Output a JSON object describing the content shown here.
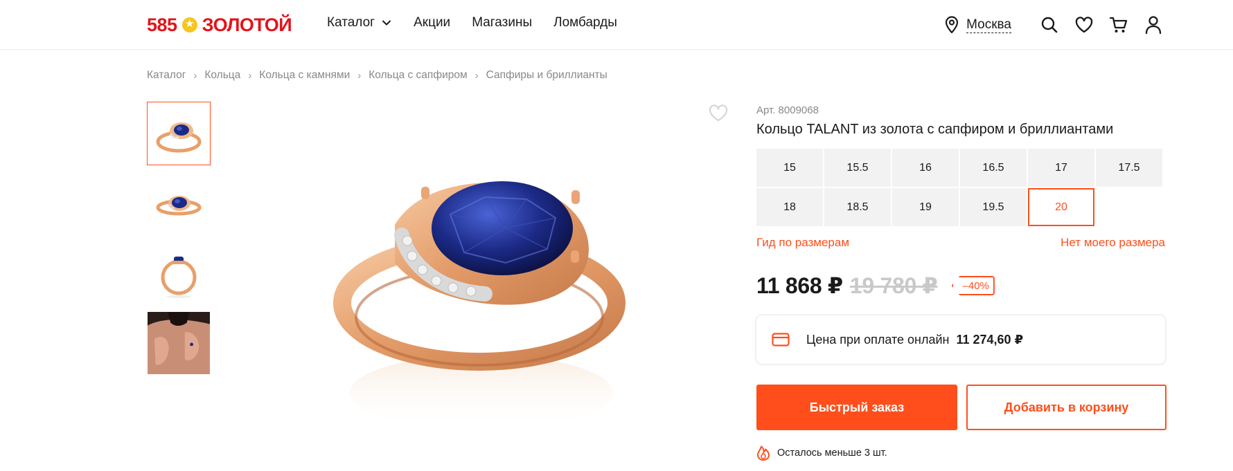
{
  "header": {
    "logo": {
      "num": "585",
      "word": "ЗОЛОТОЙ"
    },
    "nav": [
      {
        "label": "Каталог",
        "has_dropdown": true
      },
      {
        "label": "Акции"
      },
      {
        "label": "Магазины"
      },
      {
        "label": "Ломбарды"
      }
    ],
    "city": "Москва",
    "icons": [
      "location-pin-icon",
      "search-icon",
      "heart-icon",
      "cart-icon",
      "user-icon"
    ]
  },
  "breadcrumb": [
    "Каталог",
    "Кольца",
    "Кольца с камнями",
    "Кольца с сапфиром",
    "Сапфиры и бриллианты"
  ],
  "product": {
    "sku": "Арт. 8009068",
    "title": "Кольцо TALANT из золота с сапфиром и бриллиантами",
    "sizes": [
      "15",
      "15.5",
      "16",
      "16.5",
      "17",
      "17.5",
      "18",
      "18.5",
      "19",
      "19.5",
      "20"
    ],
    "selected_size": "20",
    "size_guide": "Гид по размерам",
    "no_size": "Нет моего размера",
    "price": "11 868 ₽",
    "old_price": "19 780 ₽",
    "discount": "–40%",
    "online_label": "Цена при оплате онлайн",
    "online_price": "11 274,60 ₽",
    "quick_order": "Быстрый заказ",
    "add_to_cart": "Добавить в корзину",
    "stock": "Осталось меньше 3 шт."
  },
  "colors": {
    "accent": "#ff4e1b",
    "logo_red": "#e3141b",
    "size_bg": "#f2f2f2",
    "gold": "#e8a06a",
    "sapphire": "#1c2a86"
  }
}
